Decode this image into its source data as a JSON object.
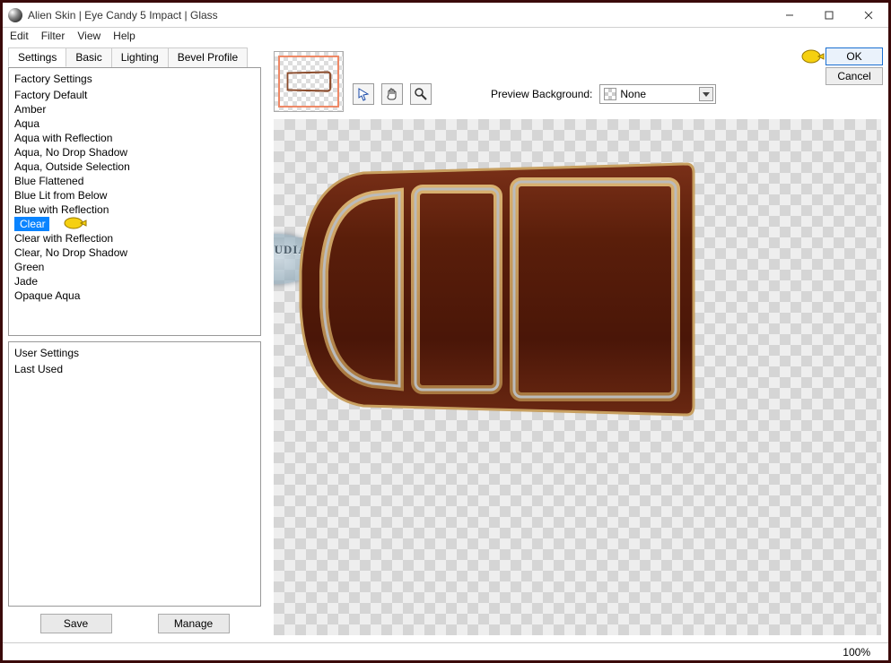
{
  "window": {
    "title": "Alien Skin | Eye Candy 5 Impact | Glass"
  },
  "menu": {
    "edit": "Edit",
    "filter": "Filter",
    "view": "View",
    "help": "Help"
  },
  "tabs": {
    "settings": "Settings",
    "basic": "Basic",
    "lighting": "Lighting",
    "bevel": "Bevel Profile"
  },
  "factory": {
    "header": "Factory Settings",
    "items": [
      "Factory Default",
      "Amber",
      "Aqua",
      "Aqua with Reflection",
      "Aqua, No Drop Shadow",
      "Aqua, Outside Selection",
      "Blue Flattened",
      "Blue Lit from Below",
      "Blue with Reflection",
      "Clear",
      "Clear with Reflection",
      "Clear, No Drop Shadow",
      "Green",
      "Jade",
      "Opaque Aqua"
    ],
    "selected_index": 9
  },
  "user": {
    "header": "User Settings",
    "items": [
      "Last Used"
    ]
  },
  "buttons": {
    "save": "Save",
    "manage": "Manage",
    "ok": "OK",
    "cancel": "Cancel"
  },
  "preview": {
    "label": "Preview Background:",
    "selected": "None"
  },
  "status": {
    "zoom": "100%"
  },
  "watermark": {
    "text": "CLAUDIA"
  }
}
